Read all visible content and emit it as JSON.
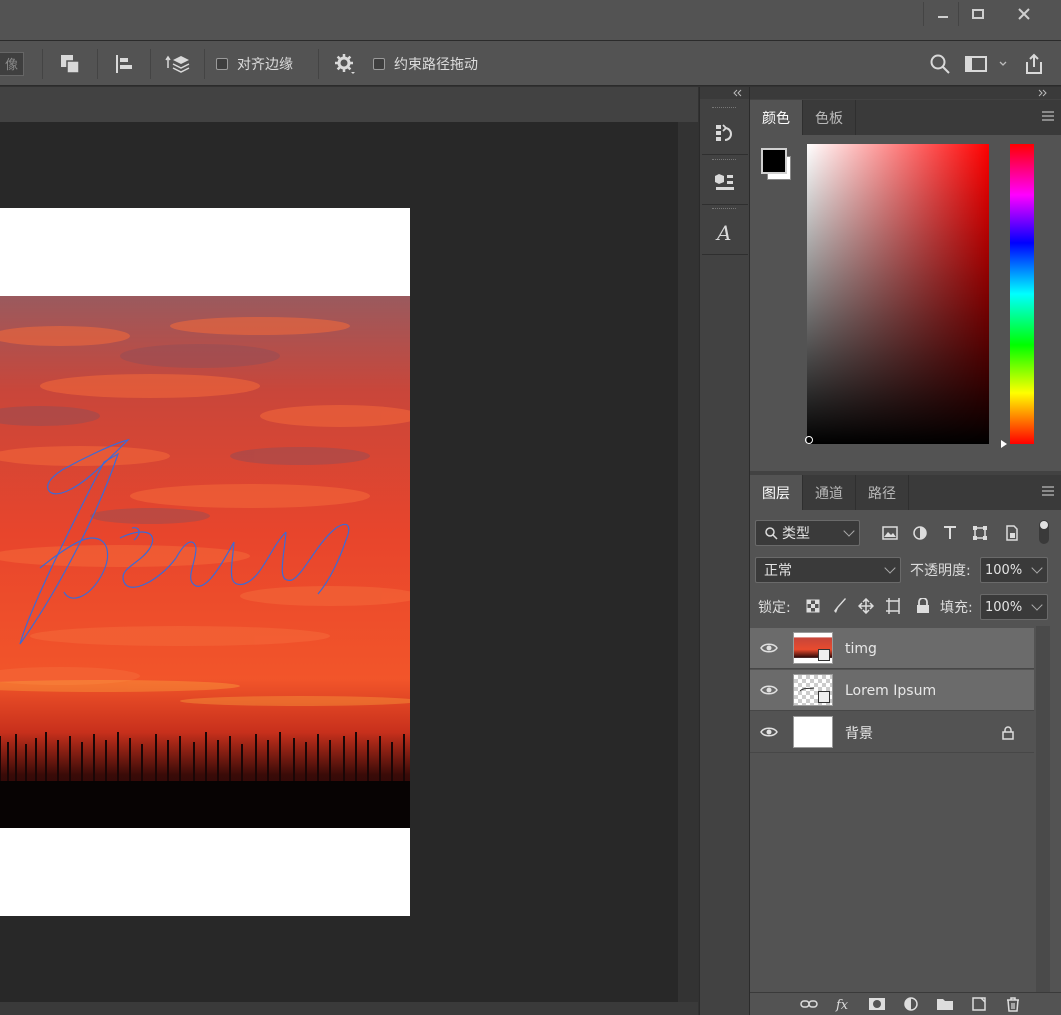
{
  "window": {
    "minimize_icon": "minimize-icon",
    "maximize_icon": "maximize-icon",
    "close_icon": "close-icon"
  },
  "options_bar": {
    "partial_label": "像",
    "align_edges_label": "对齐边缘",
    "constrain_path_drag_label": "约束路径拖动",
    "align_edges_checked": false,
    "constrain_path_checked": false
  },
  "canvas": {
    "artwork_text": "Ipsum"
  },
  "color_panel": {
    "tabs": [
      "颜色",
      "色板"
    ],
    "foreground": "#000000",
    "background": "#ffffff"
  },
  "layers_panel": {
    "tabs": [
      "图层",
      "通道",
      "路径"
    ],
    "filter_label": "类型",
    "blend_mode": "正常",
    "opacity_label": "不透明度:",
    "opacity_value": "100%",
    "lock_label": "锁定:",
    "fill_label": "填充:",
    "fill_value": "100%",
    "layers": [
      {
        "name": "timg",
        "selected": true,
        "thumb": "photo"
      },
      {
        "name": "Lorem Ipsum",
        "selected": true,
        "thumb": "transparent"
      },
      {
        "name": "背景",
        "selected": false,
        "thumb": "white",
        "locked": true
      }
    ]
  },
  "colors": {
    "ui_bg": "#535353",
    "canvas_bg": "#282828",
    "path_stroke": "#3d6ad6"
  }
}
